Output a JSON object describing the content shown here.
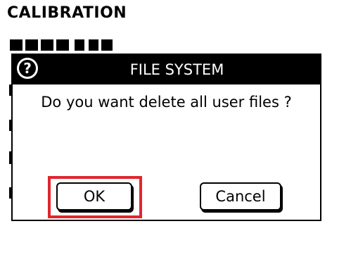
{
  "background": {
    "title": "CALIBRATION"
  },
  "dialog": {
    "title": "FILE SYSTEM",
    "icon": "help-circle-icon",
    "message": "Do you want delete all user files ?",
    "ok_label": "OK",
    "cancel_label": "Cancel",
    "focused_button": "OK",
    "focus_color": "#e0262e",
    "header_color": "#000000"
  }
}
